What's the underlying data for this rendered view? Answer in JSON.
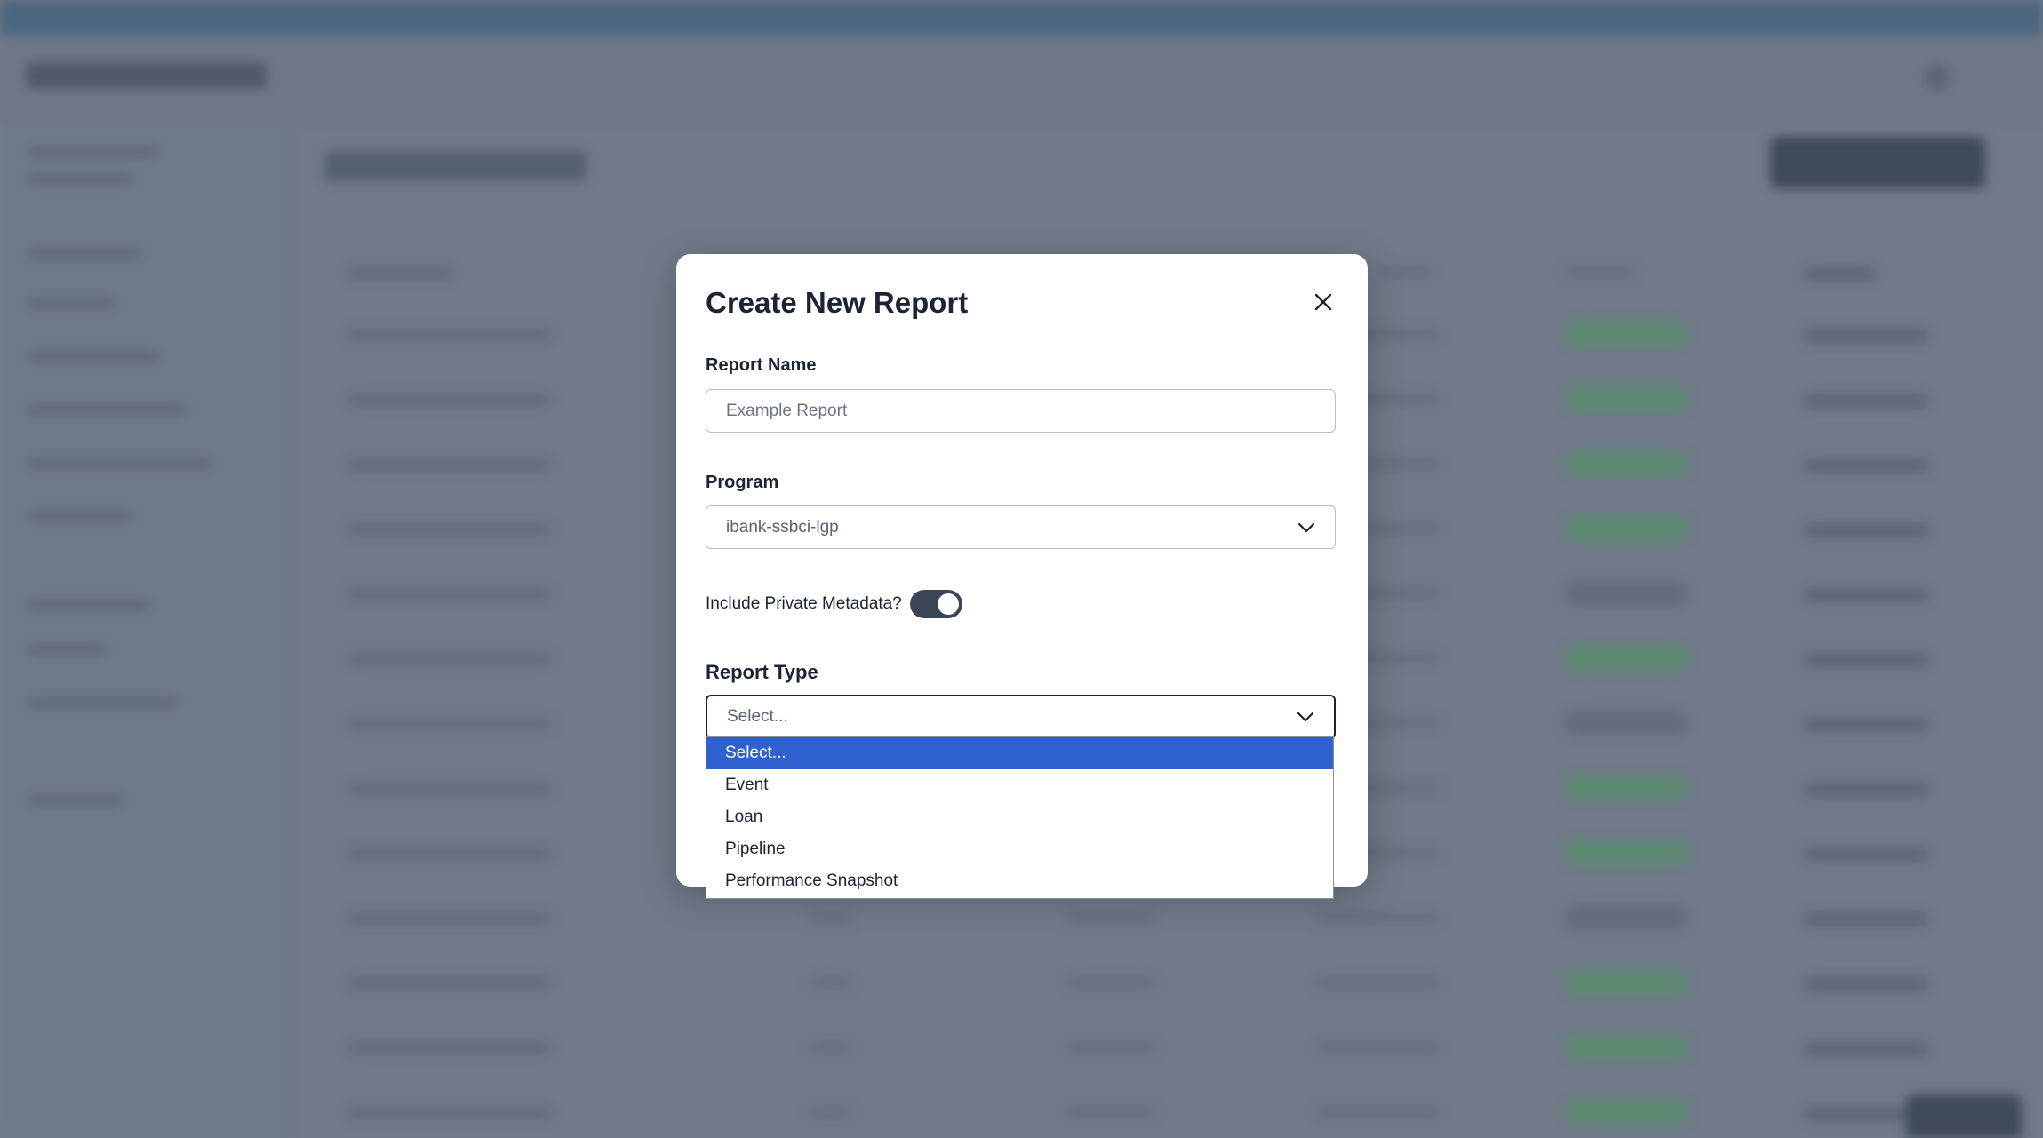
{
  "modal": {
    "title": "Create New Report",
    "report_name": {
      "label": "Report Name",
      "placeholder": "Example Report",
      "value": ""
    },
    "program": {
      "label": "Program",
      "value": "ibank-ssbci-lgp"
    },
    "private_metadata": {
      "label": "Include Private Metadata?",
      "enabled": true
    },
    "report_type": {
      "label": "Report Type",
      "value": "Select...",
      "options": [
        "Select...",
        "Event",
        "Loan",
        "Pipeline",
        "Performance Snapshot"
      ]
    }
  },
  "colors": {
    "overlay": "#707a88",
    "toggle_on": "#3a4556",
    "option_highlight": "#2f62cf"
  },
  "icons": [
    "close-icon",
    "chevron-down-icon"
  ]
}
